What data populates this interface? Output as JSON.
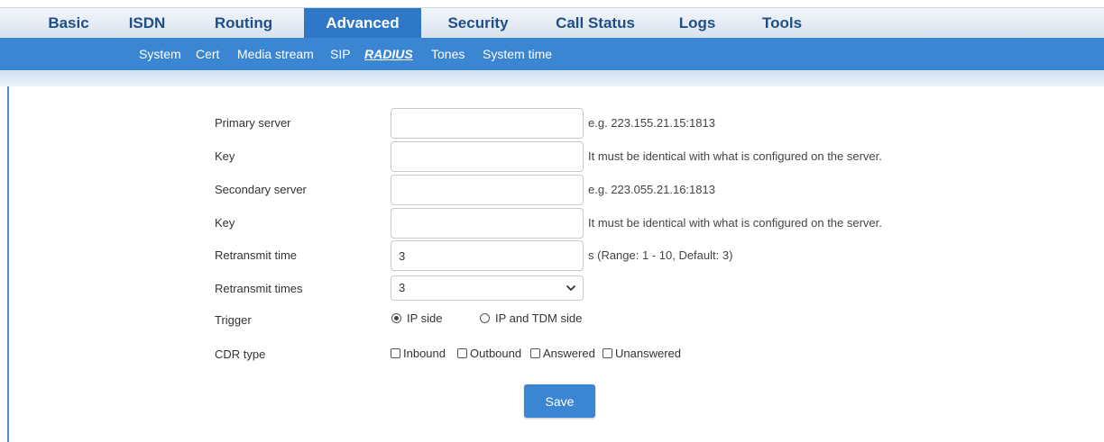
{
  "nav": {
    "tabs": [
      "Basic",
      "ISDN",
      "Routing",
      "Advanced",
      "Security",
      "Call Status",
      "Logs",
      "Tools"
    ],
    "active_tab": "Advanced",
    "subtabs": [
      "System",
      "Cert",
      "Media stream",
      "SIP",
      "RADIUS",
      "Tones",
      "System time"
    ],
    "active_subtab": "RADIUS"
  },
  "form": {
    "primary_server": {
      "label": "Primary server",
      "value": "",
      "hint": "e.g. 223.155.21.15:1813"
    },
    "primary_key": {
      "label": "Key",
      "value": "",
      "hint": "It must be identical with what is configured on the server."
    },
    "secondary_server": {
      "label": "Secondary server",
      "value": "",
      "hint": "e.g. 223.055.21.16:1813"
    },
    "secondary_key": {
      "label": "Key",
      "value": "",
      "hint": "It must be identical with what is configured on the server."
    },
    "retransmit_time": {
      "label": "Retransmit time",
      "value": "3",
      "hint": "s (Range: 1 - 10, Default: 3)"
    },
    "retransmit_times": {
      "label": "Retransmit times",
      "value": "3"
    },
    "trigger": {
      "label": "Trigger",
      "options": [
        "IP side",
        "IP and TDM side"
      ],
      "selected": "IP side"
    },
    "cdr_type": {
      "label": "CDR type",
      "options": [
        "Inbound",
        "Outbound",
        "Answered",
        "Unanswered"
      ],
      "checked": []
    }
  },
  "actions": {
    "save_label": "Save"
  },
  "colors": {
    "accent": "#3a86d3",
    "active_tab": "#2f78c7",
    "nav_text": "#1f4f8a"
  }
}
